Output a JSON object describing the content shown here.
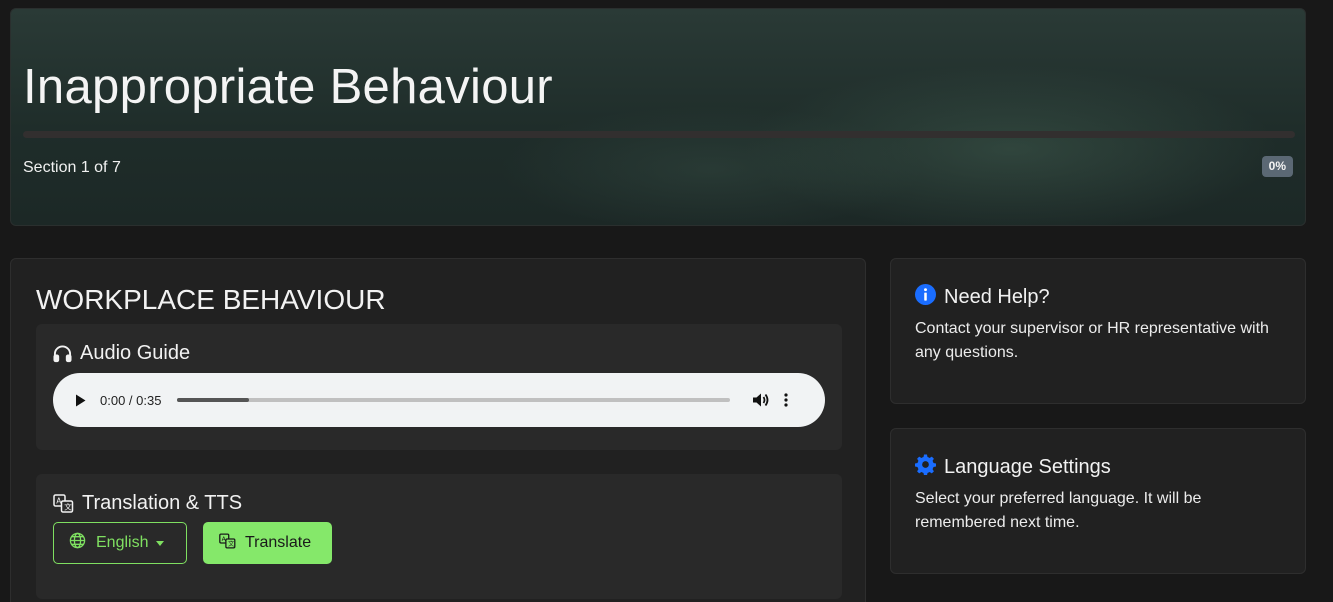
{
  "hero": {
    "title": "Inappropriate Behaviour",
    "section_label": "Section 1 of 7",
    "progress_percent": 0,
    "progress_label": "0%"
  },
  "main": {
    "title": "WORKPLACE BEHAVIOUR",
    "audio": {
      "heading": "Audio Guide",
      "time": "0:00 / 0:35",
      "buffered_fraction": 0.13,
      "icon": "headphones-icon"
    },
    "translation": {
      "heading": "Translation & TTS",
      "language_label": "English",
      "translate_label": "Translate",
      "icon": "translate-icon"
    }
  },
  "sidebar": {
    "help": {
      "title": "Need Help?",
      "text": "Contact your supervisor or HR representative with any questions.",
      "icon": "info-icon"
    },
    "language": {
      "title": "Language Settings",
      "text": "Select your preferred language. It will be remembered next time.",
      "icon": "gear-icon"
    }
  },
  "colors": {
    "accent_green": "#85e86a",
    "info_blue": "#1a6dff",
    "background": "#181818",
    "card": "#212121"
  }
}
